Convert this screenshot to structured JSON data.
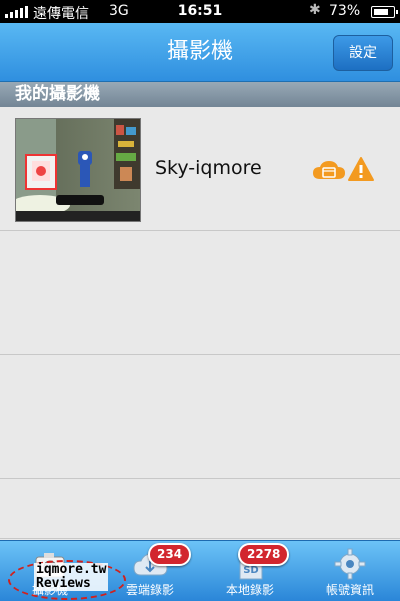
{
  "status_bar": {
    "carrier": "遠傳電信",
    "network": "3G",
    "time": "16:51",
    "battery_pct": "73%"
  },
  "nav": {
    "title": "攝影機",
    "settings_label": "設定"
  },
  "section_header": "我的攝影機",
  "cameras": [
    {
      "name": "Sky-iqmore",
      "status_icons": [
        "cloud-recording-icon",
        "warning-icon"
      ]
    }
  ],
  "tabs": [
    {
      "label": "攝影機",
      "icon": "camera-icon",
      "active": true
    },
    {
      "label": "雲端錄影",
      "icon": "cloud-icon",
      "badge": "234"
    },
    {
      "label": "本地錄影",
      "icon": "sd-card-icon",
      "badge": "2278"
    },
    {
      "label": "帳號資訊",
      "icon": "gear-icon"
    }
  ],
  "watermark": {
    "line1": "iqmore.tw",
    "line2": "Reviews"
  },
  "colors": {
    "nav_blue": "#2f8fdf",
    "tab_blue": "#2a86d8",
    "warning_orange": "#f39a20",
    "badge_red": "#d2262e"
  }
}
